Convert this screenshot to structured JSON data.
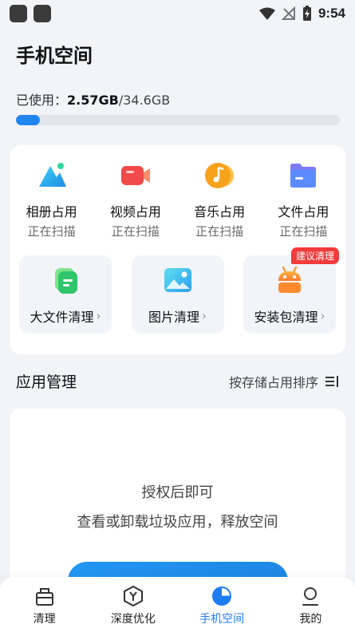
{
  "status_bar": {
    "time": "9:54"
  },
  "page": {
    "title": "手机空间"
  },
  "usage": {
    "label": "已使用：",
    "used": "2.57GB",
    "total": "/34.6GB",
    "fraction": 0.074
  },
  "categories": [
    {
      "label": "相册占用",
      "status": "正在扫描",
      "icon": "photo-album-icon"
    },
    {
      "label": "视频占用",
      "status": "正在扫描",
      "icon": "video-icon"
    },
    {
      "label": "音乐占用",
      "status": "正在扫描",
      "icon": "music-icon"
    },
    {
      "label": "文件占用",
      "status": "正在扫描",
      "icon": "folder-icon"
    }
  ],
  "tools": [
    {
      "label": "大文件清理",
      "icon": "large-file-icon"
    },
    {
      "label": "图片清理",
      "icon": "image-icon"
    },
    {
      "label": "安装包清理",
      "icon": "android-icon",
      "badge": "建议清理"
    }
  ],
  "app_management": {
    "title": "应用管理",
    "sort_label": "按存储占用排序"
  },
  "auth": {
    "title": "授权后即可",
    "desc": "查看或卸载垃圾应用，释放空间"
  },
  "nav": [
    {
      "label": "清理",
      "icon": "cleaner-icon",
      "active": false
    },
    {
      "label": "深度优化",
      "icon": "optimize-icon",
      "active": false
    },
    {
      "label": "手机空间",
      "icon": "storage-pie-icon",
      "active": true
    },
    {
      "label": "我的",
      "icon": "profile-icon",
      "active": false
    }
  ],
  "colors": {
    "accent": "#1e7cf2",
    "badge": "#f23b3b",
    "background": "#f2f4f8"
  }
}
